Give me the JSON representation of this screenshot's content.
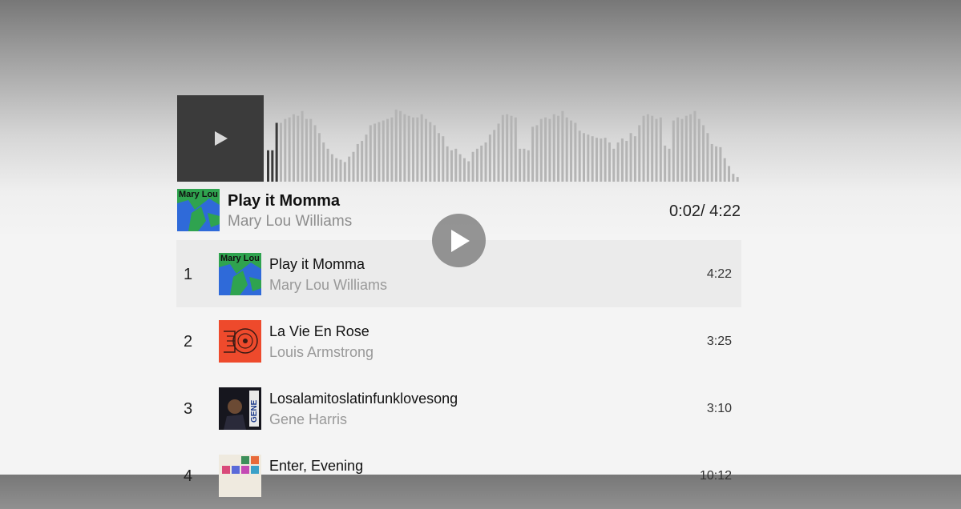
{
  "player": {
    "play_icon": "play-icon",
    "waveform": {
      "played_fraction": 0.03,
      "played_color": "#3a3a3a",
      "unplayed_color": "#b4b4b4",
      "levels": [
        0.4,
        0.4,
        0.75,
        0.75,
        0.8,
        0.82,
        0.86,
        0.84,
        0.9,
        0.8,
        0.8,
        0.72,
        0.62,
        0.5,
        0.42,
        0.35,
        0.3,
        0.28,
        0.25,
        0.32,
        0.38,
        0.48,
        0.52,
        0.6,
        0.72,
        0.74,
        0.76,
        0.78,
        0.8,
        0.82,
        0.92,
        0.9,
        0.86,
        0.84,
        0.82,
        0.82,
        0.86,
        0.8,
        0.76,
        0.72,
        0.62,
        0.58,
        0.45,
        0.4,
        0.42,
        0.35,
        0.3,
        0.26,
        0.38,
        0.42,
        0.46,
        0.5,
        0.6,
        0.66,
        0.74,
        0.85,
        0.86,
        0.84,
        0.82,
        0.42,
        0.42,
        0.4,
        0.7,
        0.72,
        0.8,
        0.82,
        0.8,
        0.86,
        0.84,
        0.9,
        0.82,
        0.78,
        0.75,
        0.65,
        0.62,
        0.6,
        0.58,
        0.56,
        0.55,
        0.56,
        0.5,
        0.42,
        0.5,
        0.55,
        0.52,
        0.62,
        0.58,
        0.72,
        0.84,
        0.86,
        0.84,
        0.8,
        0.82,
        0.46,
        0.42,
        0.78,
        0.82,
        0.8,
        0.84,
        0.86,
        0.9,
        0.8,
        0.72,
        0.62,
        0.48,
        0.45,
        0.44,
        0.3,
        0.2,
        0.1,
        0.06
      ]
    }
  },
  "now_playing": {
    "title": "Play it Momma",
    "artist": "Mary Lou Williams",
    "time": "0:02/ 4:22",
    "art_text": "Mary Lou"
  },
  "overlay": {
    "play_icon": "play-icon"
  },
  "tracks": [
    {
      "num": "1",
      "title": "Play it Momma",
      "artist": "Mary Lou Williams",
      "duration": "4:22",
      "art": "mary-lou-cover",
      "art_text": "Mary Lou"
    },
    {
      "num": "2",
      "title": "La Vie En Rose",
      "artist": "Louis Armstrong",
      "duration": "3:25",
      "art": "louis-armstrong-cover"
    },
    {
      "num": "3",
      "title": "Losalamitoslatinfunklovesong",
      "artist": "Gene Harris",
      "duration": "3:10",
      "art": "gene-harris-cover",
      "art_text": "GENE"
    },
    {
      "num": "4",
      "title": "Enter, Evening",
      "artist": "",
      "duration": "10:12",
      "art": "enter-evening-cover"
    }
  ],
  "colors": {
    "active_row": "#ebebeb",
    "play_box": "#3b3b3b",
    "mary_green": "#2fa34f",
    "mary_blue": "#2f6ad9",
    "louis_red": "#ee4a2c"
  }
}
